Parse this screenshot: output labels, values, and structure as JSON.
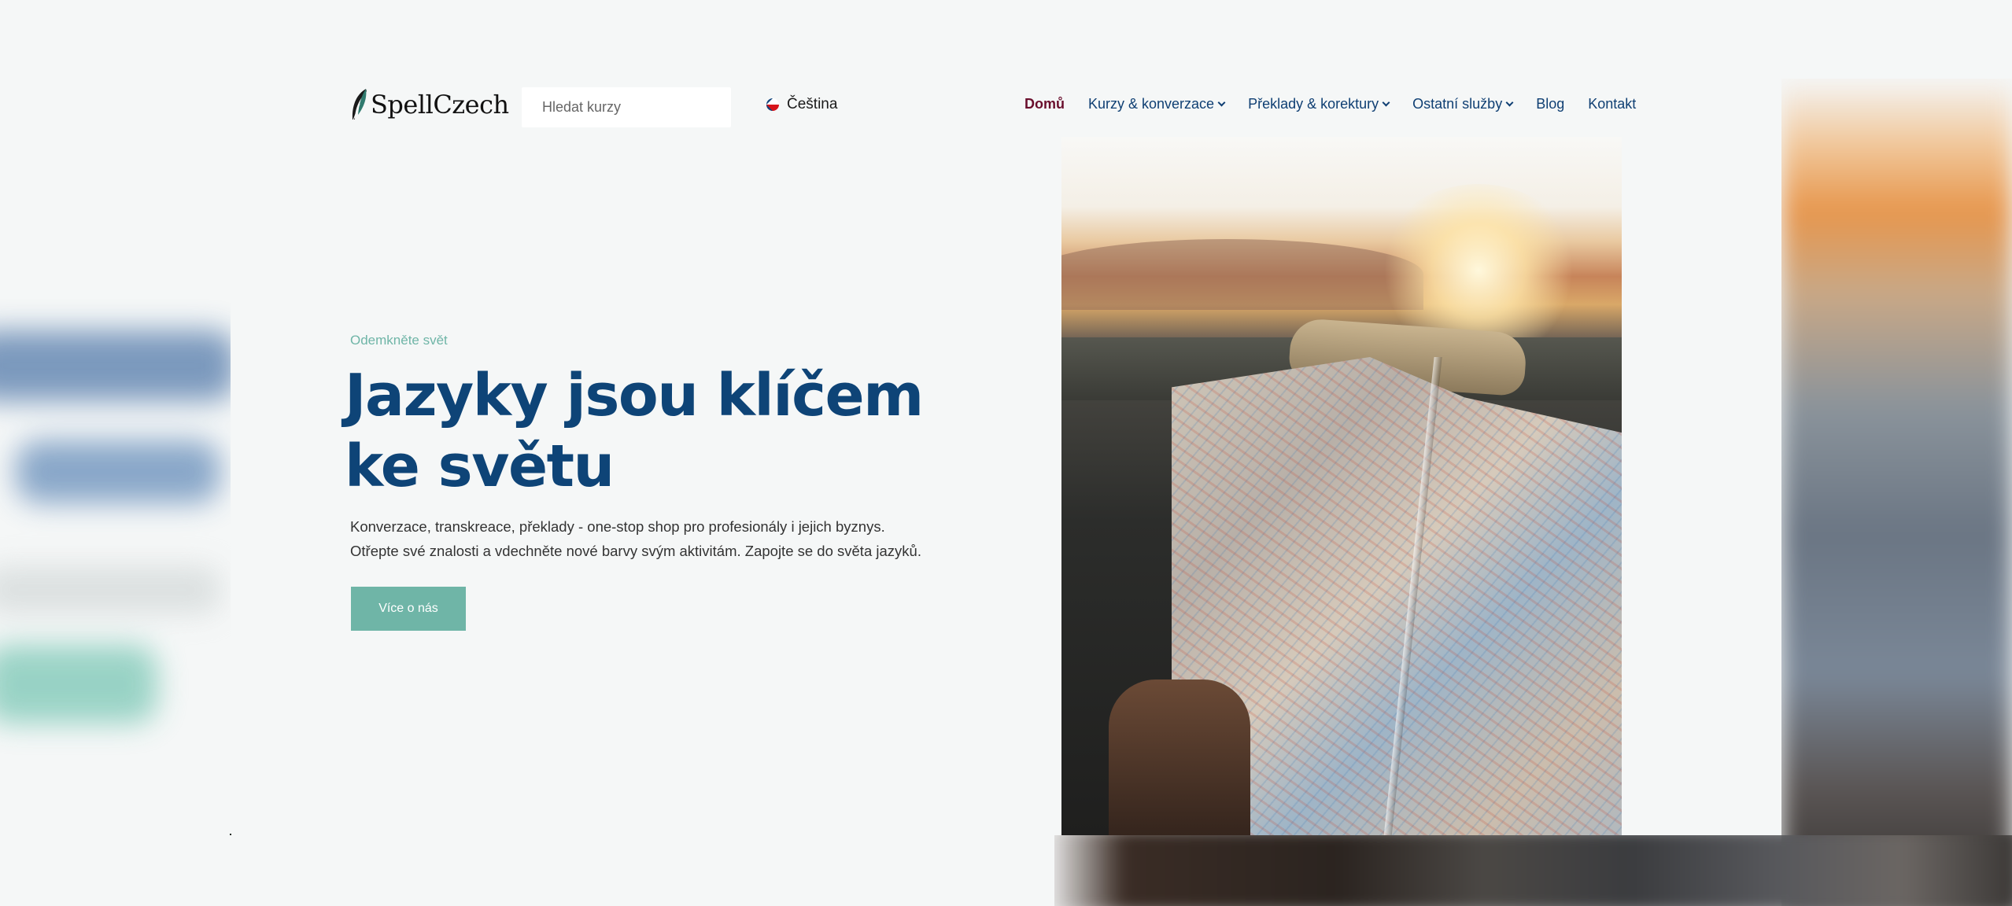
{
  "brand": {
    "name": "SpellCzech"
  },
  "search": {
    "placeholder": "Hledat kurzy"
  },
  "language": {
    "label": "Čeština"
  },
  "nav": [
    {
      "label": "Domů",
      "active": true,
      "dropdown": false
    },
    {
      "label": "Kurzy & konverzace",
      "active": false,
      "dropdown": true
    },
    {
      "label": "Překlady & korektury",
      "active": false,
      "dropdown": true
    },
    {
      "label": "Ostatní služby",
      "active": false,
      "dropdown": true
    },
    {
      "label": "Blog",
      "active": false,
      "dropdown": false
    },
    {
      "label": "Kontakt",
      "active": false,
      "dropdown": false
    }
  ],
  "hero": {
    "eyebrow": "Odemkněte svět",
    "title": "Jazyky jsou klíčem ke světu",
    "description": "Konverzace, transkreace, překlady - one-stop shop pro profesionály i jejich byznys. Otřepte své znalosti a vdechněte nové barvy svým aktivitám. Zapojte se do světa jazyků.",
    "cta_label": "Více o nás",
    "image": "map-in-car-photo"
  },
  "colors": {
    "accent": "#6fb5a7",
    "heading": "#0e4477",
    "nav_active": "#6a0f2d",
    "background": "#f5f7f7"
  }
}
